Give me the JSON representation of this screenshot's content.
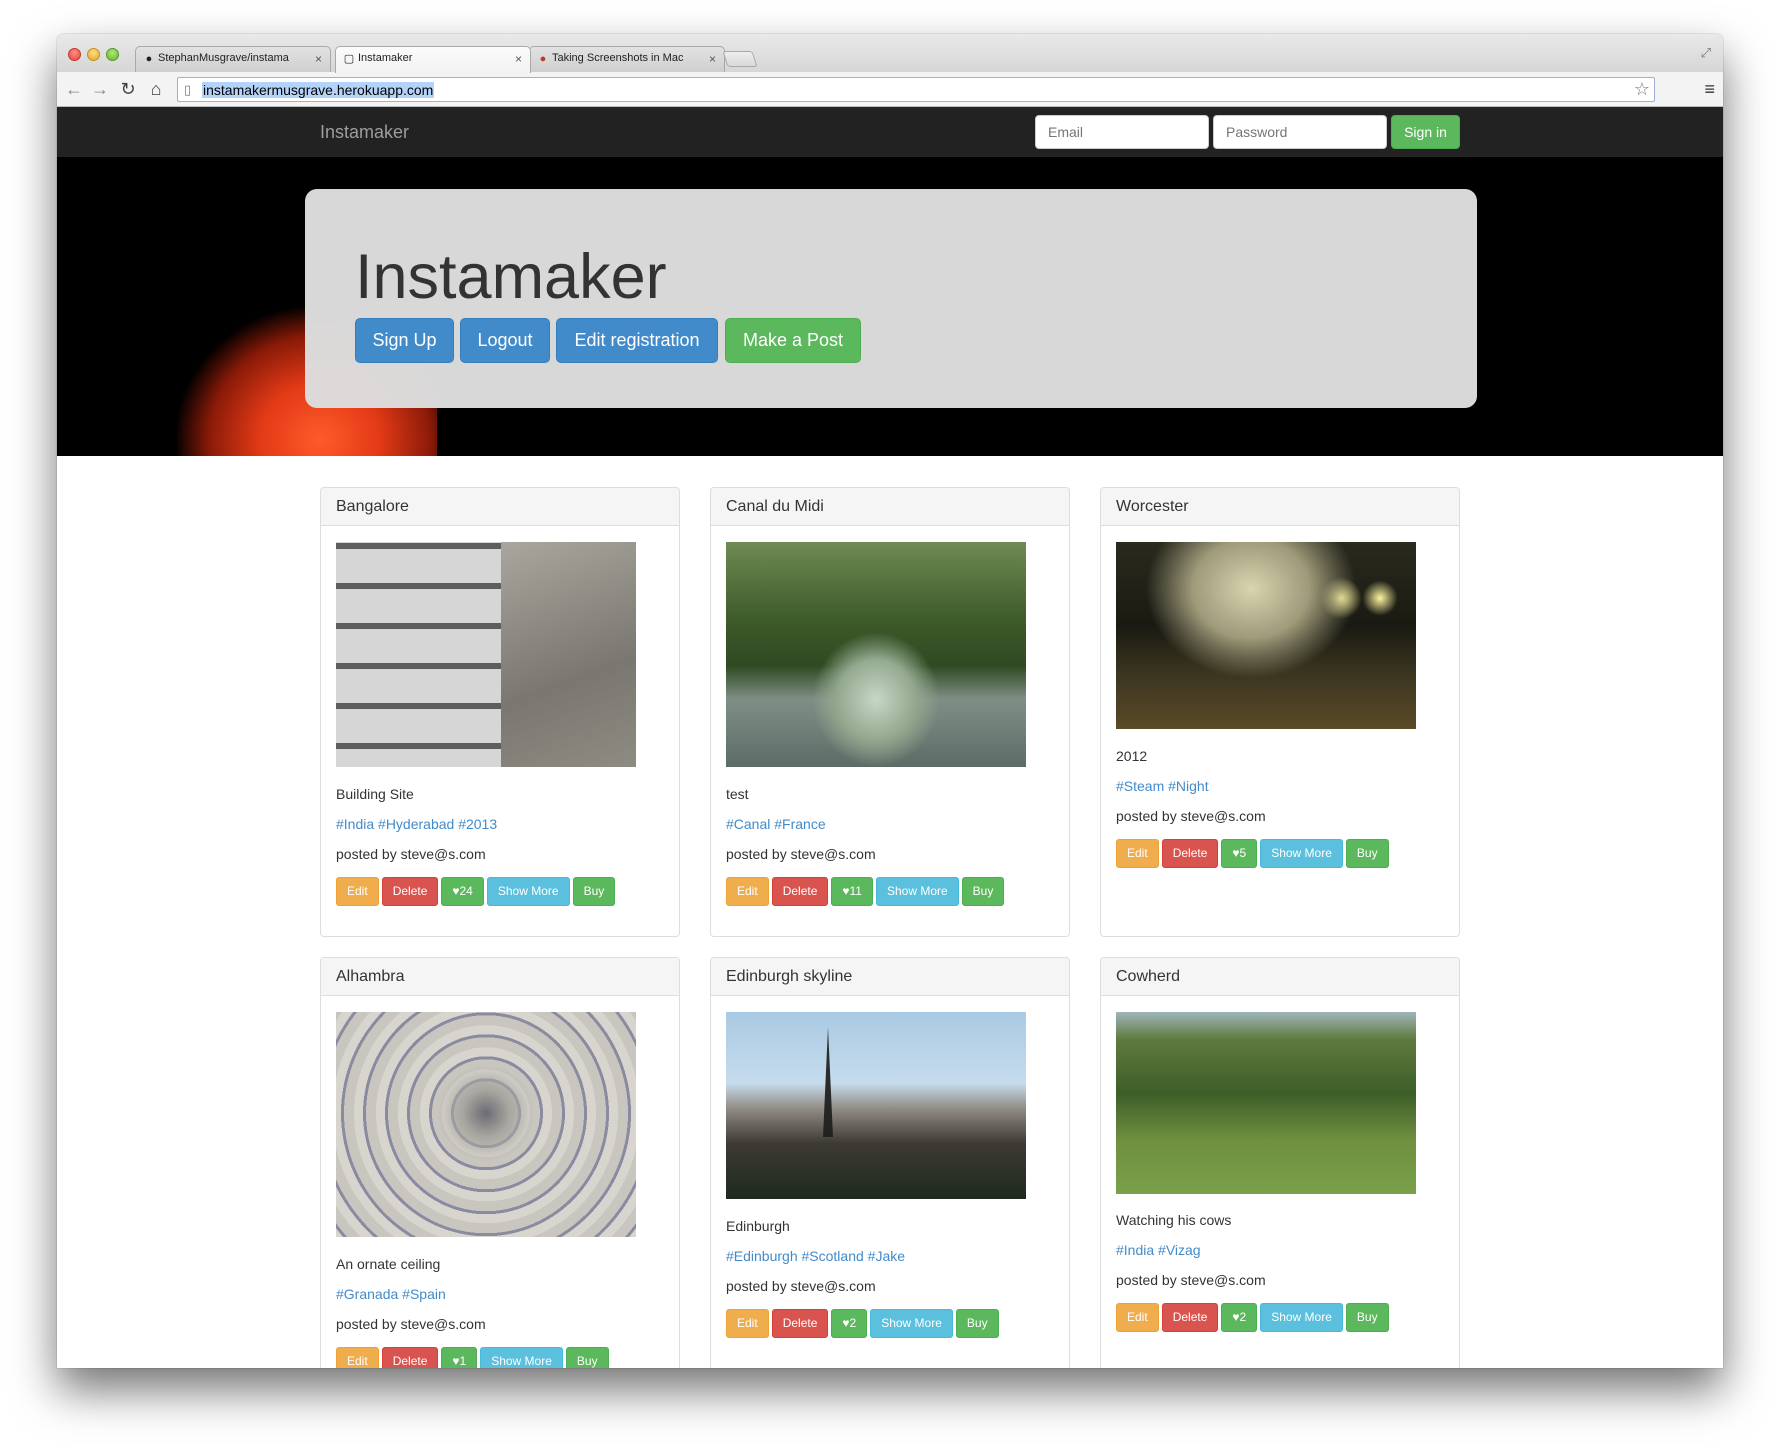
{
  "browser": {
    "tabs": [
      {
        "title": "StephanMusgrave/instama",
        "icon": "github-icon"
      },
      {
        "title": "Instamaker",
        "icon": "page-icon"
      },
      {
        "title": "Taking Screenshots in Mac",
        "icon": "apple-icon"
      }
    ],
    "url": "instamakermusgrave.herokuapp.com"
  },
  "navbar": {
    "brand": "Instamaker",
    "email_placeholder": "Email",
    "password_placeholder": "Password",
    "signin_label": "Sign in"
  },
  "hero": {
    "title": "Instamaker",
    "buttons": {
      "signup": "Sign Up",
      "logout": "Logout",
      "edit_registration": "Edit registration",
      "make_post": "Make a Post"
    }
  },
  "actions": {
    "edit": "Edit",
    "delete": "Delete",
    "show_more": "Show More",
    "buy": "Buy"
  },
  "posts": [
    {
      "title": "Bangalore",
      "description": "Building Site",
      "tags": "#India #Hyderabad #2013",
      "author": "posted by steve@s.com",
      "likes": "♥24"
    },
    {
      "title": "Canal du Midi",
      "description": "test",
      "tags": "#Canal #France",
      "author": "posted by steve@s.com",
      "likes": "♥11"
    },
    {
      "title": "Worcester",
      "description": "2012",
      "tags": "#Steam #Night",
      "author": "posted by steve@s.com",
      "likes": "♥5"
    },
    {
      "title": "Alhambra",
      "description": "An ornate ceiling",
      "tags": "#Granada #Spain",
      "author": "posted by steve@s.com",
      "likes": "♥1"
    },
    {
      "title": "Edinburgh skyline",
      "description": "Edinburgh",
      "tags": "#Edinburgh #Scotland #Jake",
      "author": "posted by steve@s.com",
      "likes": "♥2"
    },
    {
      "title": "Cowherd",
      "description": "Watching his cows",
      "tags": "#India #Vizag",
      "author": "posted by steve@s.com",
      "likes": "♥2"
    }
  ],
  "colors": {
    "primary": "#428bca",
    "success": "#5cb85c",
    "warning": "#f0ad4e",
    "danger": "#d9534f",
    "info": "#5bc0de",
    "navbar": "#222222"
  }
}
